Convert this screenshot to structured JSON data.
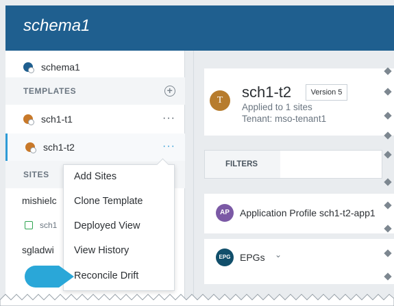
{
  "header": {
    "title": "schema1"
  },
  "sidebar": {
    "schema_item": "schema1",
    "templates_section": "TEMPLATES",
    "templates": [
      {
        "label": "sch1-t1"
      },
      {
        "label": "sch1-t2"
      }
    ],
    "ellipsis": "···",
    "sites_section": "SITES",
    "sites": [
      {
        "label": "mishielc"
      },
      {
        "label": "sch1"
      },
      {
        "label": "sgladwi"
      }
    ]
  },
  "context_menu": {
    "items": [
      {
        "label": "Add Sites"
      },
      {
        "label": "Clone Template"
      },
      {
        "label": "Deployed View"
      },
      {
        "label": "View History"
      },
      {
        "label": "Reconcile Drift"
      }
    ]
  },
  "template_card": {
    "avatar_letter": "T",
    "name": "sch1-t2",
    "version": "Version 5",
    "applied": "Applied to 1 sites",
    "tenant": "Tenant: mso-tenant1"
  },
  "filters": {
    "label": "FILTERS"
  },
  "app_profile": {
    "badge": "AP",
    "label": "Application Profile sch1-t2-app1"
  },
  "epgs": {
    "badge": "EPG",
    "label": "EPGs"
  },
  "colors": {
    "header": "#1f5f8f",
    "accent": "#2d9bd6",
    "pointer": "#2aa7d8"
  }
}
